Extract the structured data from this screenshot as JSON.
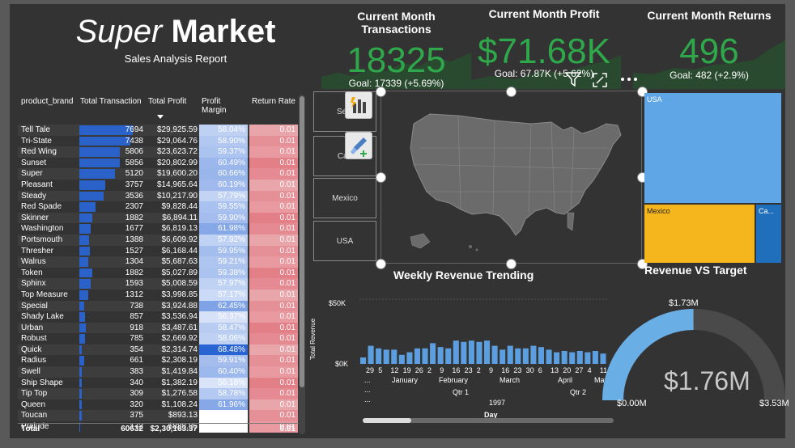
{
  "header": {
    "title_italic": "Super",
    "title_bold": "Market",
    "subtitle": "Sales Analysis Report"
  },
  "kpis": [
    {
      "title": "Current Month Transactions",
      "value": "18325",
      "goal": "Goal: 17339 (+5.69%)"
    },
    {
      "title": "Current Month Profit",
      "value": "$71.68K",
      "goal": "Goal: 67.87K (+5.62%)"
    },
    {
      "title": "Current Month Returns",
      "value": "496",
      "goal": "Goal: 482 (+2.9%)"
    }
  ],
  "table": {
    "columns": [
      "product_brand",
      "Total Transaction",
      "Total Profit",
      "Profit Margin",
      "Return Rate"
    ],
    "rows": [
      {
        "brand": "Tell Tale",
        "trans": 7694,
        "trans_label": "7694",
        "profit": "$29,925.59",
        "margin": "58.04%",
        "rr": "0.01"
      },
      {
        "brand": "Tri-State",
        "trans": 7438,
        "trans_label": "7438",
        "profit": "$29,064.76",
        "margin": "58.90%",
        "rr": "0.01"
      },
      {
        "brand": "Red Wing",
        "trans": 5806,
        "trans_label": "5806",
        "profit": "$23,623.72",
        "margin": "59.37%",
        "rr": "0.01"
      },
      {
        "brand": "Sunset",
        "trans": 5856,
        "trans_label": "5856",
        "profit": "$20,802.99",
        "margin": "60.49%",
        "rr": "0.01"
      },
      {
        "brand": "Super",
        "trans": 5120,
        "trans_label": "5120",
        "profit": "$19,600.20",
        "margin": "60.66%",
        "rr": "0.01"
      },
      {
        "brand": "Pleasant",
        "trans": 3757,
        "trans_label": "3757",
        "profit": "$14,965.64",
        "margin": "60.19%",
        "rr": "0.01"
      },
      {
        "brand": "Steady",
        "trans": 3536,
        "trans_label": "3536",
        "profit": "$10,217.90",
        "margin": "57.79%",
        "rr": "0.01"
      },
      {
        "brand": "Red Spade",
        "trans": 2307,
        "trans_label": "2307",
        "profit": "$9,828.44",
        "margin": "59.55%",
        "rr": "0.01"
      },
      {
        "brand": "Skinner",
        "trans": 1882,
        "trans_label": "1882",
        "profit": "$6,894.11",
        "margin": "59.90%",
        "rr": "0.01"
      },
      {
        "brand": "Washington",
        "trans": 1677,
        "trans_label": "1677",
        "profit": "$6,819.13",
        "margin": "61.98%",
        "rr": "0.01"
      },
      {
        "brand": "Portsmouth",
        "trans": 1388,
        "trans_label": "1388",
        "profit": "$6,609.92",
        "margin": "57.92%",
        "rr": "0.01"
      },
      {
        "brand": "Thresher",
        "trans": 1527,
        "trans_label": "1527",
        "profit": "$6,168.44",
        "margin": "59.95%",
        "rr": "0.01"
      },
      {
        "brand": "Walrus",
        "trans": 1304,
        "trans_label": "1304",
        "profit": "$5,687.63",
        "margin": "59.21%",
        "rr": "0.01"
      },
      {
        "brand": "Token",
        "trans": 1882,
        "trans_label": "1882",
        "profit": "$5,027.89",
        "margin": "59.38%",
        "rr": "0.01"
      },
      {
        "brand": "Sphinx",
        "trans": 1593,
        "trans_label": "1593",
        "profit": "$5,008.59",
        "margin": "57.97%",
        "rr": "0.01"
      },
      {
        "brand": "Top Measure",
        "trans": 1312,
        "trans_label": "1312",
        "profit": "$3,998.85",
        "margin": "57.17%",
        "rr": "0.01"
      },
      {
        "brand": "Special",
        "trans": 738,
        "trans_label": "738",
        "profit": "$3,924.88",
        "margin": "62.45%",
        "rr": "0.01"
      },
      {
        "brand": "Shady Lake",
        "trans": 857,
        "trans_label": "857",
        "profit": "$3,536.94",
        "margin": "56.37%",
        "rr": "0.01"
      },
      {
        "brand": "Urban",
        "trans": 918,
        "trans_label": "918",
        "profit": "$3,487.61",
        "margin": "58.47%",
        "rr": "0.01"
      },
      {
        "brand": "Robust",
        "trans": 785,
        "trans_label": "785",
        "profit": "$2,669.92",
        "margin": "58.06%",
        "rr": "0.01"
      },
      {
        "brand": "Quick",
        "trans": 354,
        "trans_label": "354",
        "profit": "$2,314.74",
        "margin": "68.48%",
        "rr": "0.01"
      },
      {
        "brand": "Radius",
        "trans": 661,
        "trans_label": "661",
        "profit": "$2,308.19",
        "margin": "59.91%",
        "rr": "0.01"
      },
      {
        "brand": "Swell",
        "trans": 383,
        "trans_label": "383",
        "profit": "$1,419.84",
        "margin": "60.40%",
        "rr": "0.01"
      },
      {
        "brand": "Ship Shape",
        "trans": 340,
        "trans_label": "340",
        "profit": "$1,382.19",
        "margin": "56.18%",
        "rr": "0.01"
      },
      {
        "brand": "Tip Top",
        "trans": 309,
        "trans_label": "309",
        "profit": "$1,276.58",
        "margin": "58.78%",
        "rr": "0.01"
      },
      {
        "brand": "Queen",
        "trans": 320,
        "trans_label": "320",
        "profit": "$1,108.24",
        "margin": "61.96%",
        "rr": "0.01"
      },
      {
        "brand": "Toucan",
        "trans": 375,
        "trans_label": "375",
        "profit": "$893.13",
        "margin": "",
        "rr": "0.01"
      },
      {
        "brand": "Prelude",
        "trans": 172,
        "trans_label": "172",
        "profit": "$888.86",
        "margin": "",
        "rr": "0.01"
      }
    ],
    "total": {
      "label": "Total",
      "trans": "60632",
      "profit": "$2,30,163.37",
      "margin": "59.32%",
      "rr": "0.01"
    }
  },
  "slicer": {
    "items": [
      "Sele",
      "Can",
      "Mexico",
      "USA"
    ]
  },
  "treemap": {
    "items": [
      {
        "label": "USA",
        "color": "#5ea6e6"
      },
      {
        "label": "Mexico",
        "color": "#f5b51c"
      },
      {
        "label": "Ca...",
        "color": "#1f6fbd"
      }
    ]
  },
  "weekly": {
    "title": "Weekly Revenue Trending",
    "ylabel": "Total Revenue",
    "xlabel": "Day",
    "ytick_top": "$50K",
    "ytick_bottom": "$0K",
    "day_ticks": [
      "29",
      "5",
      "12",
      "19",
      "26",
      "2",
      "9",
      "16",
      "23",
      "2",
      "9",
      "16",
      "23",
      "30",
      "6",
      "13",
      "20",
      "27",
      "4",
      "11"
    ],
    "months": [
      "January",
      "February",
      "March",
      "April",
      "May"
    ],
    "quarters": [
      "Qtr 1",
      "Qtr 2"
    ],
    "year": "1997",
    "ellipsis": "..."
  },
  "chart_data": {
    "type": "bar",
    "ylabel": "Total Revenue",
    "xlabel": "Day",
    "ylim": [
      0,
      50000
    ],
    "values": [
      5000,
      14000,
      12000,
      11000,
      11000,
      7000,
      9000,
      12000,
      12000,
      16000,
      13000,
      12000,
      18000,
      17000,
      18000,
      17000,
      18000,
      14000,
      11000,
      14000,
      12000,
      12000,
      14000,
      13000,
      11000,
      9000,
      10000,
      9000,
      10000,
      9000,
      10000,
      8000
    ]
  },
  "gauge": {
    "title": "Revenue VS Target",
    "value_label": "$1.76M",
    "target_label": "$1.73M",
    "min_label": "$0.00M",
    "max_label": "$3.53M",
    "value": 1.76,
    "max": 3.53,
    "color": "#6aaee6"
  }
}
